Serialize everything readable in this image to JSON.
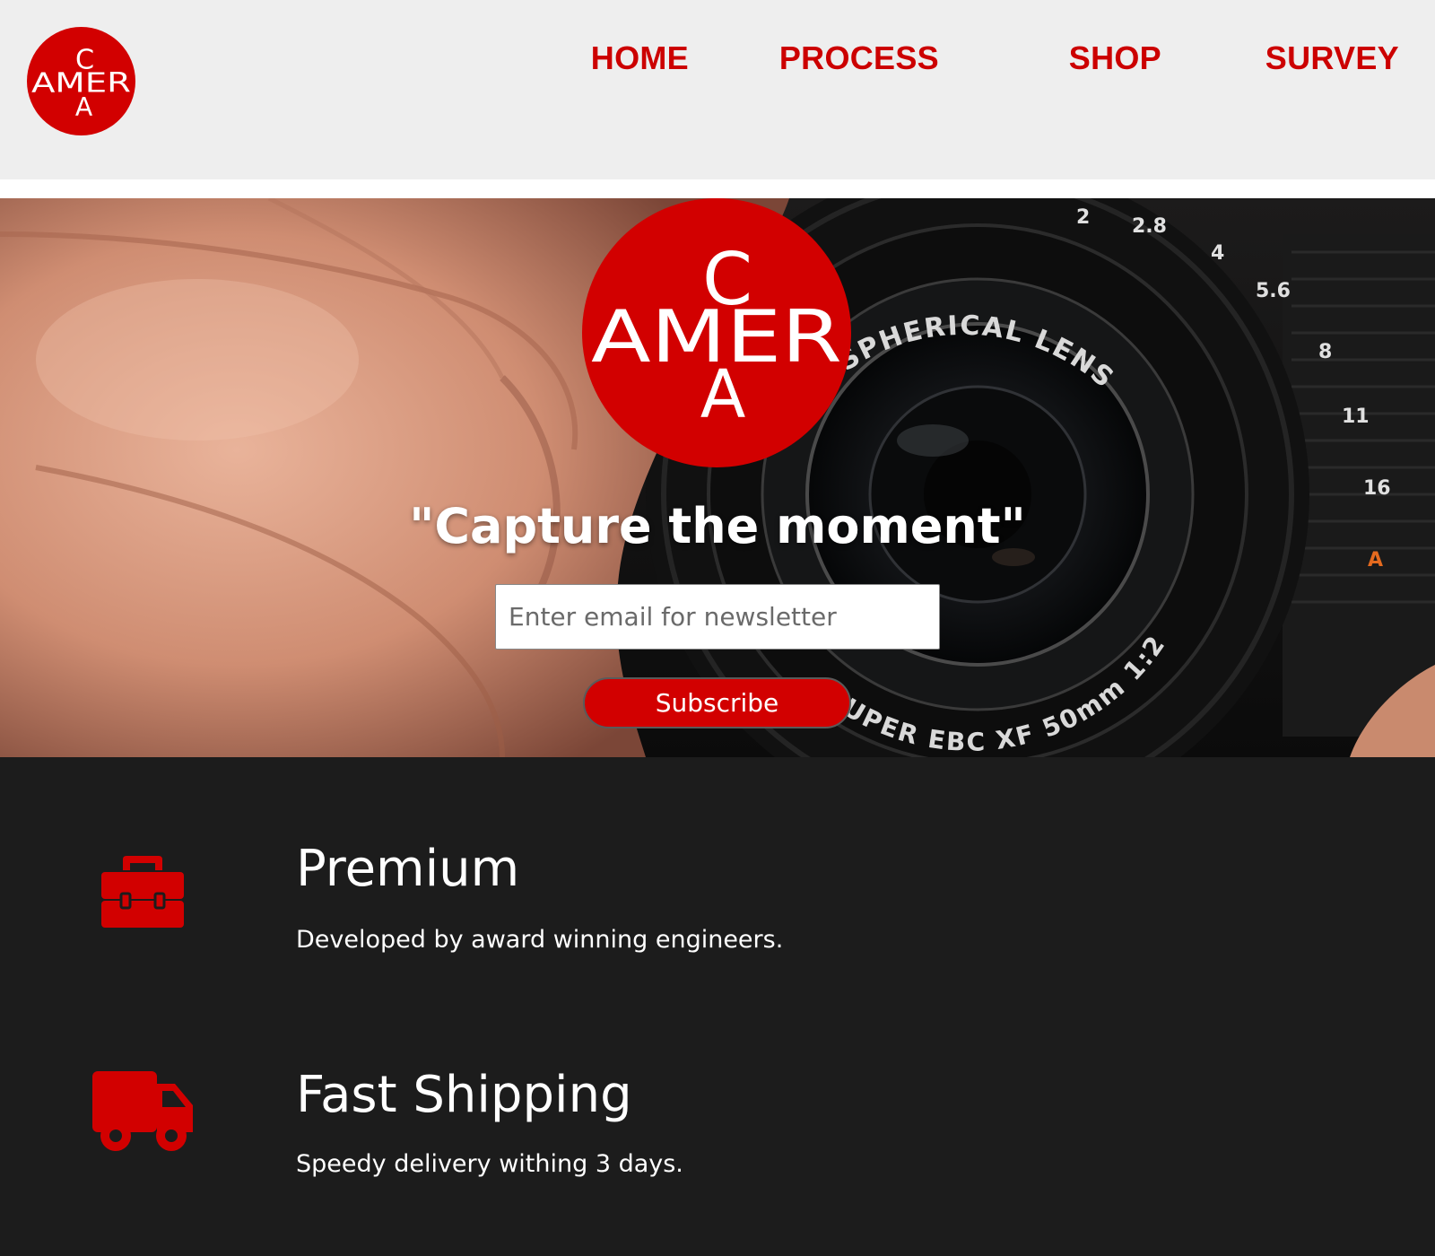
{
  "brand": {
    "name": "CAMERA",
    "logo_letters": {
      "top": "C",
      "middle": "AMER",
      "bottom": "A"
    },
    "accent_color": "#d20000"
  },
  "nav": {
    "items": [
      {
        "label": "HOME"
      },
      {
        "label": "PROCESS"
      },
      {
        "label": "SHOP"
      },
      {
        "label": "SURVEY"
      }
    ],
    "color": "#cc0000"
  },
  "hero": {
    "tagline": "\"Capture the moment\"",
    "newsletter": {
      "placeholder": "Enter email for newsletter",
      "value": "",
      "button_label": "Subscribe"
    },
    "lens_text": {
      "top": "ON ASPHERICAL LENS",
      "bottom": "SUPER EBC XF 50mm 1:2",
      "scale": [
        "2",
        "2.8",
        "4",
        "5.6",
        "8",
        "11",
        "16",
        "A"
      ]
    }
  },
  "features": [
    {
      "icon": "toolbox-icon",
      "title": "Premium",
      "description": "Developed by award winning engineers."
    },
    {
      "icon": "truck-icon",
      "title": "Fast Shipping",
      "description": "Speedy delivery withing 3 days."
    }
  ]
}
